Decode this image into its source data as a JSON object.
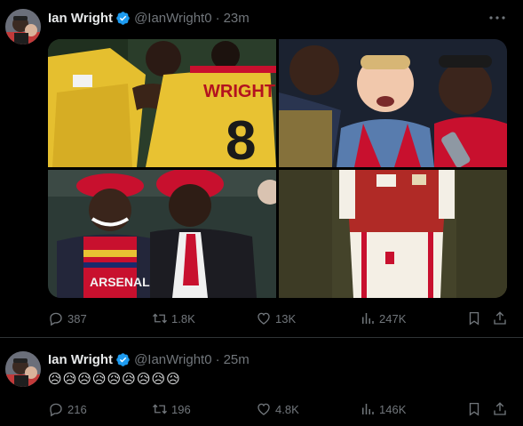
{
  "tweets": [
    {
      "display_name": "Ian Wright",
      "handle": "@IanWright0",
      "separator": "·",
      "time": "23m",
      "jersey_text": "WRIGHT",
      "jersey_number": "8",
      "scarf_text": "ARSENAL",
      "stats": {
        "replies": "387",
        "retweets": "1.8K",
        "likes": "13K",
        "views": "247K"
      }
    },
    {
      "display_name": "Ian Wright",
      "handle": "@IanWright0",
      "separator": "·",
      "time": "25m",
      "text": "😥😥😥😥😥😥😥😥😥",
      "stats": {
        "replies": "216",
        "retweets": "196",
        "likes": "4.8K",
        "views": "146K"
      }
    }
  ],
  "icons": {
    "verified": "verified-badge-icon",
    "more": "more-icon",
    "reply": "reply-icon",
    "retweet": "retweet-icon",
    "like": "heart-icon",
    "views": "views-icon",
    "bookmark": "bookmark-icon",
    "share": "share-icon"
  },
  "colors": {
    "background": "#000000",
    "text": "#e7e9ea",
    "muted": "#71767b",
    "verified": "#1d9bf0",
    "divider": "#2f3336",
    "arsenal_yellow": "#e8c232",
    "arsenal_red": "#c8102e"
  }
}
